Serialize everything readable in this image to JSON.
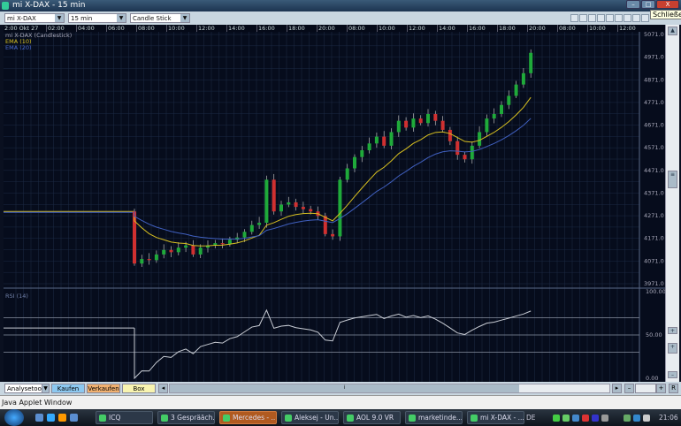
{
  "window": {
    "title": "mi X-DAX - 15 min",
    "tooltip": "Schließen",
    "minimize": "–",
    "maximize": "□",
    "close": "X"
  },
  "toolbar": {
    "instrument": "mi X-DAX",
    "interval": "15 min",
    "chart_type": "Candle Stick (Kerze"
  },
  "time_axis": [
    "2:00 Okt 27",
    "02:00",
    "04:00",
    "06:00",
    "08:00",
    "10:00",
    "12:00",
    "14:00",
    "16:00",
    "18:00",
    "20:00",
    "08:00",
    "10:00",
    "12:00",
    "14:00",
    "16:00",
    "18:00",
    "20:00",
    "08:00",
    "10:00",
    "12:00"
  ],
  "legend": {
    "series": "mi X-DAX (Candlestick)",
    "ema10": "EMA (10)",
    "ema20": "EMA (20)",
    "rsi": "RSI (14)"
  },
  "colors": {
    "up": "#1faa3a",
    "down": "#d03030",
    "ema10": "#d8c020",
    "ema20": "#4060c0",
    "rsi": "#c8ccd4",
    "grid": "#1c2a44",
    "background": "#060c1c"
  },
  "price_axis": [
    "5071.0",
    "4971.0",
    "4871.0",
    "4771.0",
    "4671.0",
    "4571.0",
    "4471.0",
    "4371.0",
    "4271.0",
    "4171.0",
    "4071.0",
    "3971.0"
  ],
  "rsi_axis": [
    "100.00",
    "50.00",
    "0.00"
  ],
  "chart_data": {
    "type": "candlestick",
    "ylim": [
      3971,
      5071
    ],
    "flat_price": 4290,
    "closes": [
      4060,
      4080,
      4075,
      4100,
      4120,
      4110,
      4130,
      4140,
      4100,
      4130,
      4140,
      4150,
      4145,
      4165,
      4175,
      4200,
      4230,
      4240,
      4430,
      4290,
      4320,
      4330,
      4310,
      4300,
      4290,
      4270,
      4190,
      4180,
      4430,
      4480,
      4530,
      4560,
      4590,
      4620,
      4580,
      4640,
      4690,
      4660,
      4700,
      4680,
      4720,
      4690,
      4650,
      4600,
      4540,
      4520,
      4580,
      4640,
      4700,
      4720,
      4760,
      4800,
      4850,
      4900,
      4990
    ],
    "rsi_levels": [
      70,
      50,
      30
    ],
    "rsi_ylim": [
      0,
      100
    ]
  },
  "bottom": {
    "analysis_tool": "Analysetool",
    "buy": "Kaufen",
    "sell": "Verkaufen",
    "box": "Box setzen",
    "scroll_left": "◂",
    "scroll_right": "▸",
    "zoom_out": "–",
    "zoom_in": "+",
    "reset": "R"
  },
  "status": "Java Applet Window",
  "taskbar": {
    "items": [
      {
        "label": "ICQ"
      },
      {
        "label": "3 Gesprääch..."
      },
      {
        "label": "Mercedes - ..."
      },
      {
        "label": "Aleksej - Un..."
      },
      {
        "label": "AOL 9.0 VR"
      },
      {
        "label": "marketinde..."
      },
      {
        "label": "mi X-DAX - ..."
      }
    ],
    "lang": "DE",
    "clock": "21:06"
  }
}
